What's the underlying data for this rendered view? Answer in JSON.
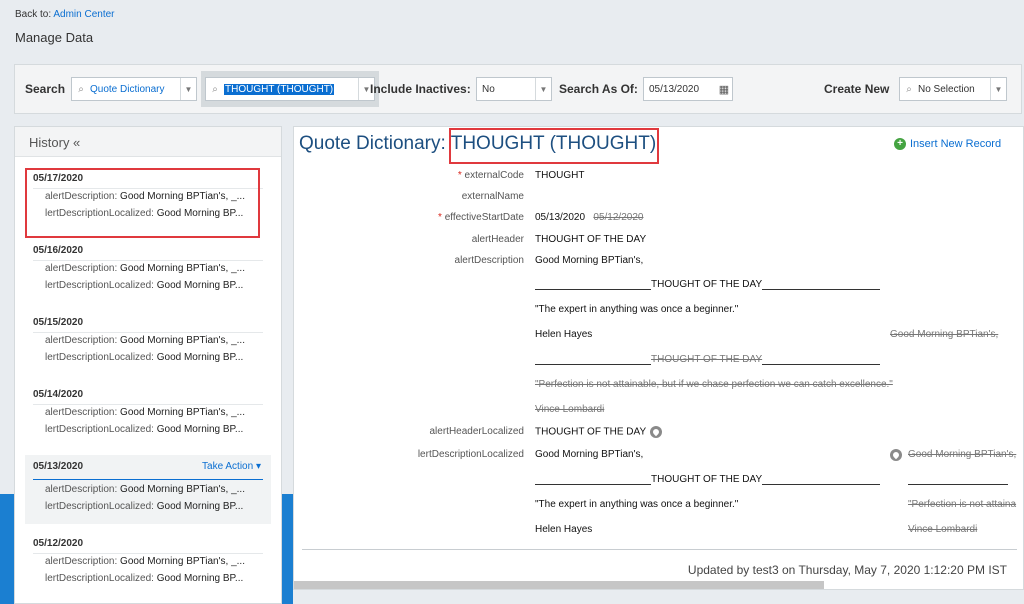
{
  "header": {
    "back_prefix": "Back to:",
    "back_link": "Admin Center",
    "page_title": "Manage Data"
  },
  "search": {
    "search_label": "Search",
    "object_type": "Quote Dictionary",
    "object_value": "THOUGHT (THOUGHT)",
    "include_inactives_label": "Include Inactives:",
    "include_inactives_value": "No",
    "search_as_of_label": "Search As Of:",
    "search_as_of_value": "05/13/2020",
    "create_new_label": "Create New",
    "create_new_value": "No Selection"
  },
  "history": {
    "title": "History «",
    "take_action": "Take Action",
    "key1": "alertDescription:",
    "key2": "lertDescriptionLocalized:",
    "val1": "Good Morning BPTian's, _...",
    "val2": "Good Morning BP...",
    "items": [
      {
        "date": "05/17/2020"
      },
      {
        "date": "05/16/2020"
      },
      {
        "date": "05/15/2020"
      },
      {
        "date": "05/14/2020"
      },
      {
        "date": "05/13/2020"
      },
      {
        "date": "05/12/2020"
      }
    ]
  },
  "record": {
    "title_prefix": "Quote Dictionary:",
    "title_value": "THOUGHT (THOUGHT)",
    "insert_new": "Insert New Record",
    "fields": {
      "externalCode_label": "externalCode",
      "externalCode_value": "THOUGHT",
      "externalName_label": "externalName",
      "effectiveStartDate_label": "effectiveStartDate",
      "effectiveStartDate_value": "05/13/2020",
      "effectiveStartDate_old": "05/12/2020",
      "alertHeader_label": "alertHeader",
      "alertHeader_value": "THOUGHT OF THE DAY",
      "alertDescription_label": "alertDescription",
      "alertHeaderLocalized_label": "alertHeaderLocalized",
      "alertHeaderLocalized_value": "THOUGHT OF THE DAY",
      "alertDescriptionLocalized_label": "lertDescriptionLocalized"
    },
    "desc": {
      "greeting": "Good Morning BPTian's,",
      "mid": "THOUGHT OF THE DAY",
      "quote": "\"The expert in anything was once a beginner.\"",
      "author": "Helen Hayes",
      "old_greeting": "Good Morning BPTian's,",
      "old_quote": "\"Perfection is not attainable, but if we chase perfection we can catch excellence.\"",
      "old_quote_short": "\"Perfection is not attaina",
      "old_author": "Vince Lombardi"
    },
    "updated": "Updated by test3 on Thursday, May 7, 2020 1:12:20 PM IST"
  }
}
